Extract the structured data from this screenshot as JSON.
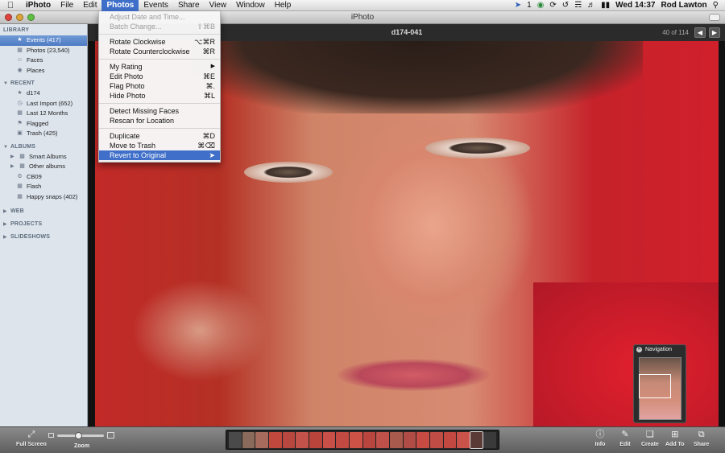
{
  "menubar": {
    "app": "iPhoto",
    "items": [
      "File",
      "Edit",
      "Photos",
      "Events",
      "Share",
      "View",
      "Window",
      "Help"
    ],
    "status_number": "1",
    "clock": "Wed 14:37",
    "user": "Rod Lawton"
  },
  "window": {
    "title": "iPhoto"
  },
  "sidebar": {
    "library_header": "LIBRARY",
    "library": [
      {
        "label": "Events (417)",
        "icon": "events-icon"
      },
      {
        "label": "Photos (23,540)",
        "icon": "photos-icon"
      },
      {
        "label": "Faces",
        "icon": "faces-icon"
      },
      {
        "label": "Places",
        "icon": "places-icon"
      }
    ],
    "recent_header": "RECENT",
    "recent": [
      {
        "label": "d174"
      },
      {
        "label": "Last Import (652)"
      },
      {
        "label": "Last 12 Months"
      },
      {
        "label": "Flagged"
      },
      {
        "label": "Trash (425)"
      }
    ],
    "albums_header": "ALBUMS",
    "albums": [
      {
        "label": "Smart Albums"
      },
      {
        "label": "Other albums"
      },
      {
        "label": "CB09"
      },
      {
        "label": "Flash"
      },
      {
        "label": "Happy snaps (402)"
      }
    ],
    "web_header": "WEB",
    "projects_header": "PROJECTS",
    "slideshows_header": "SLIDESHOWS"
  },
  "viewer": {
    "photo_title": "d174-041",
    "position": "40 of 114"
  },
  "photos_menu": {
    "items": [
      {
        "label": "Adjust Date and Time...",
        "shortcut": ""
      },
      {
        "label": "Batch Change...",
        "shortcut": "⇧⌘B"
      },
      {
        "label": "Rotate Clockwise",
        "shortcut": "⌥⌘R"
      },
      {
        "label": "Rotate Counterclockwise",
        "shortcut": "⌘R"
      },
      {
        "label": "My Rating",
        "shortcut": "▶"
      },
      {
        "label": "Edit Photo",
        "shortcut": "⌘E"
      },
      {
        "label": "Flag Photo",
        "shortcut": "⌘."
      },
      {
        "label": "Hide Photo",
        "shortcut": "⌘L"
      },
      {
        "label": "Detect Missing Faces",
        "shortcut": ""
      },
      {
        "label": "Rescan for Location",
        "shortcut": ""
      },
      {
        "label": "Duplicate",
        "shortcut": "⌘D"
      },
      {
        "label": "Move to Trash",
        "shortcut": "⌘⌫"
      },
      {
        "label": "Revert to Original",
        "shortcut": ""
      }
    ]
  },
  "navigation_panel": {
    "title": "Navigation"
  },
  "toolbar": {
    "full_screen": "Full Screen",
    "zoom": "Zoom",
    "info": "Info",
    "edit": "Edit",
    "create": "Create",
    "add_to": "Add To",
    "share": "Share"
  },
  "colors": {
    "menu_highlight": "#3f6fc9",
    "sidebar_selection": "#5b86c9"
  }
}
